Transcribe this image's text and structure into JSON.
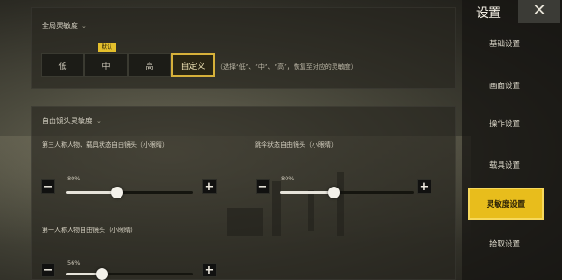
{
  "global_sensitivity": {
    "title": "全局灵敏度",
    "caret": "⌄",
    "options": [
      "低",
      "中",
      "高",
      "自定义"
    ],
    "selected": "自定义",
    "badge": "默认",
    "hint": "（选择“低”、“中”、“高”，恢复至对应的灵敏度）"
  },
  "free_camera": {
    "title": "自由镜头灵敏度",
    "caret": "⌄",
    "sliders": [
      {
        "label": "第三人称人物、载具状态自由镜头（小眼睛）",
        "value_text": "80%",
        "value": 0.8
      },
      {
        "label": "跳伞状态自由镜头（小眼睛）",
        "value_text": "80%",
        "value": 0.8
      },
      {
        "label": "第一人称人物自由镜头（小眼睛）",
        "value_text": "56%",
        "value": 0.56
      }
    ],
    "minus": "−",
    "plus": "+"
  },
  "nav": {
    "title": "设置",
    "close": "✕",
    "items": [
      "基础设置",
      "画面设置",
      "操作设置",
      "载具设置",
      "灵敏度设置",
      "拾取设置"
    ],
    "active": "灵敏度设置"
  },
  "colors": {
    "accent": "#e8bd1c",
    "selected_border": "#d7b13a"
  }
}
